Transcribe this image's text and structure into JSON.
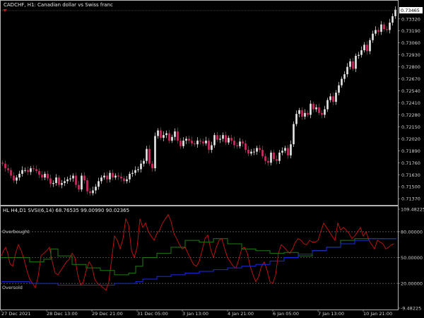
{
  "colors": {
    "background": "#000000",
    "frame": "#b4b4b4",
    "candle_bull": "#e8e8e8",
    "candle_bear": "#d12a66",
    "price_tag_bg": "#ffffff",
    "price_tag_text": "#000000",
    "line_red": "#c81414",
    "line_green": "#1f7a14",
    "line_blue": "#1a2ae6",
    "level_line": "#8c8c8c"
  },
  "chart_title": "CADCHF,  H1:  Canadian dollar vs Swiss franc",
  "current_price_tag": "0.73465",
  "icon": "arrow-down-icon",
  "price_scale": [
    "0.73320",
    "0.73190",
    "0.73060",
    "0.72930",
    "0.72800",
    "0.72670",
    "0.72540",
    "0.72410",
    "0.72280",
    "0.72150",
    "0.72020",
    "0.71890",
    "0.71760",
    "0.71630",
    "0.71500",
    "0.71370"
  ],
  "indicator_title": "HL H4,D1 SVSI(6,14) 68.76535 99.00990 90.02365",
  "indicator_scale": [
    "109.48225",
    "80.00000",
    "50.00000",
    "20.00000",
    "-9.48225"
  ],
  "levels": {
    "overbought": "Overbought",
    "oversold": "Oversold"
  },
  "time_labels": [
    "27 Dec 2021",
    "28 Dec 13:00",
    "29 Dec 21:00",
    "31 Dec 05:00",
    "3 Jan 13:00",
    "4 Jan 21:00",
    "6 Jan 05:00",
    "7 Jan 13:00",
    "10 Jan 21:00"
  ],
  "chart_data": [
    {
      "type": "candlestick",
      "title": "CADCHF,  H1:  Canadian dollar vs Swiss franc",
      "ylim": [
        0.7131,
        0.7351
      ],
      "x": [
        0,
        4,
        8,
        12,
        16,
        20,
        24,
        28,
        32,
        36,
        40,
        44,
        48,
        52,
        56,
        60,
        64,
        68,
        72,
        76,
        80,
        84,
        88,
        92,
        96,
        100,
        104,
        108,
        112,
        116,
        120,
        124,
        128,
        132,
        136,
        140,
        144,
        148,
        152,
        156,
        160,
        164,
        168,
        172,
        176,
        180,
        184,
        188,
        192,
        196,
        200,
        204,
        208,
        212,
        216,
        220,
        224,
        228,
        232,
        236,
        240,
        244,
        248,
        252,
        256,
        260,
        264,
        268,
        272,
        276,
        280,
        284,
        288,
        292,
        296,
        300,
        304,
        308,
        312,
        316,
        320,
        324,
        328,
        332,
        336,
        340,
        344,
        348,
        352,
        356,
        360,
        364,
        368,
        372,
        376,
        380,
        384,
        388,
        392,
        396,
        400,
        404,
        408,
        412,
        416,
        420,
        424,
        428,
        432,
        436,
        440,
        444,
        448,
        452,
        456,
        460,
        464,
        468,
        472,
        476,
        480,
        484,
        488,
        492,
        496,
        500,
        504,
        508,
        512,
        516,
        520,
        524,
        528,
        532,
        536,
        540,
        544,
        548,
        552,
        556
      ],
      "close": [
        0.7175,
        0.717,
        0.7168,
        0.7162,
        0.71567,
        0.716,
        0.7164,
        0.7168,
        0.7168,
        0.7166,
        0.717,
        0.7169,
        0.7167,
        0.7163,
        0.716,
        0.7164,
        0.7159,
        0.7153,
        0.7154,
        0.716,
        0.7152,
        0.7154,
        0.7156,
        0.7158,
        0.7159,
        0.7162,
        0.7152,
        0.7147,
        0.7162,
        0.7157,
        0.7145,
        0.7143,
        0.7146,
        0.715,
        0.7156,
        0.716,
        0.7162,
        0.7158,
        0.7165,
        0.716,
        0.7162,
        0.7161,
        0.7159,
        0.7156,
        0.7158,
        0.7164,
        0.7165,
        0.7168,
        0.7169,
        0.7175,
        0.7178,
        0.7191,
        0.7175,
        0.717,
        0.7205,
        0.7211,
        0.7203,
        0.7206,
        0.7208,
        0.72,
        0.7204,
        0.721,
        0.72,
        0.7194,
        0.72,
        0.7202,
        0.72,
        0.7197,
        0.7196,
        0.72,
        0.7199,
        0.7197,
        0.72,
        0.719,
        0.7195,
        0.7206,
        0.7201,
        0.7202,
        0.7206,
        0.7198,
        0.7203,
        0.72,
        0.7195,
        0.7194,
        0.7199,
        0.7197,
        0.719,
        0.7186,
        0.7188,
        0.7188,
        0.7192,
        0.719,
        0.7183,
        0.7178,
        0.7176,
        0.7187,
        0.718,
        0.7178,
        0.7187,
        0.7189,
        0.7192,
        0.7184,
        0.7196,
        0.7218,
        0.7229,
        0.7233,
        0.7226,
        0.723,
        0.7228,
        0.724,
        0.7234,
        0.7236,
        0.723,
        0.7228,
        0.7234,
        0.7244,
        0.7248,
        0.7242,
        0.7252,
        0.726,
        0.7267,
        0.7272,
        0.728,
        0.7286,
        0.7278,
        0.7292,
        0.7293,
        0.7298,
        0.7304,
        0.7297,
        0.7309,
        0.7316,
        0.732,
        0.7318,
        0.7326,
        0.7321,
        0.732,
        0.7328,
        0.7335,
        0.7342
      ]
    },
    {
      "type": "line",
      "title": "HL H4,D1 SVSI(6,14) 68.76535 99.00990 90.02365",
      "ylim": [
        -9.48225,
        109.48225
      ],
      "series": [
        {
          "x": [
            0,
            3,
            6,
            9,
            12,
            16,
            20,
            24,
            28,
            32,
            36,
            40,
            44,
            48,
            52,
            56,
            60,
            64,
            68,
            72,
            76,
            80,
            84,
            88,
            92,
            96,
            100,
            104,
            108,
            112,
            116,
            120,
            124,
            128,
            132,
            136,
            140,
            144,
            148,
            152,
            156,
            160,
            164,
            168,
            172,
            176,
            180,
            184,
            188,
            192,
            196,
            200,
            204,
            208,
            212,
            216,
            220,
            224,
            228,
            232,
            236,
            240,
            244,
            248,
            252,
            256,
            260,
            264,
            268,
            272,
            276,
            280,
            284,
            288,
            292,
            296,
            300,
            304,
            308,
            312,
            316,
            320,
            324,
            328,
            332,
            336,
            340,
            344,
            348,
            352,
            356,
            360,
            364,
            368,
            372,
            376,
            380,
            384,
            388,
            392,
            396,
            400,
            404,
            408,
            412,
            416,
            420,
            424,
            428,
            432,
            436,
            440,
            444,
            448,
            452,
            456,
            460,
            464,
            468,
            472,
            476,
            480,
            484,
            488,
            492,
            496,
            500,
            504,
            508,
            512,
            516,
            520,
            524,
            528,
            532,
            536,
            540,
            544,
            548,
            552,
            556
          ],
          "values": [
            52,
            58,
            62,
            55,
            43,
            40,
            55,
            65,
            58,
            48,
            35,
            25,
            20,
            15,
            28,
            52,
            55,
            58,
            62,
            45,
            32,
            30,
            35,
            40,
            45,
            48,
            55,
            50,
            30,
            18,
            22,
            35,
            45,
            40,
            25,
            20,
            18,
            15,
            12,
            22,
            48,
            75,
            70,
            60,
            72,
            95,
            88,
            58,
            50,
            62,
            95,
            85,
            90,
            80,
            75,
            70,
            78,
            82,
            90,
            95,
            100,
            92,
            78,
            72,
            65,
            60,
            62,
            55,
            48,
            42,
            40,
            46,
            58,
            72,
            76,
            60,
            50,
            62,
            70,
            72,
            60,
            50,
            45,
            40,
            38,
            48,
            60,
            62,
            55,
            40,
            30,
            22,
            28,
            40,
            45,
            35,
            22,
            20,
            30,
            55,
            65,
            62,
            58,
            55,
            60,
            68,
            72,
            70,
            66,
            65,
            70,
            68,
            68,
            70,
            80,
            90,
            85,
            80,
            75,
            70,
            90,
            82,
            85,
            82,
            78,
            72,
            75,
            80,
            85,
            75,
            80,
            70,
            65,
            60,
            70,
            68,
            66,
            60,
            62,
            65,
            66
          ]
        },
        {
          "x": [
            0,
            40,
            60,
            70,
            80,
            100,
            120,
            140,
            160,
            180,
            190,
            200,
            220,
            240,
            260,
            280,
            300,
            320,
            340,
            360,
            380,
            400,
            420,
            440,
            460,
            480,
            500,
            520,
            540,
            560
          ],
          "values": [
            50,
            45,
            48,
            60,
            52,
            42,
            38,
            35,
            30,
            32,
            40,
            50,
            55,
            62,
            70,
            68,
            72,
            66,
            60,
            58,
            55,
            56,
            52,
            58,
            62,
            70,
            72,
            72,
            72,
            72
          ]
        },
        {
          "x": [
            0,
            40,
            80,
            120,
            160,
            190,
            200,
            220,
            240,
            260,
            280,
            300,
            320,
            340,
            360,
            380,
            400,
            420,
            440,
            460,
            480,
            500,
            520,
            540,
            560
          ],
          "values": [
            22,
            20,
            18,
            18,
            20,
            22,
            25,
            28,
            30,
            32,
            34,
            36,
            38,
            40,
            42,
            46,
            50,
            54,
            58,
            62,
            66,
            70,
            72,
            72,
            72
          ]
        }
      ],
      "levels": {
        "overbought": 80,
        "middle": 50,
        "oversold": 20
      }
    }
  ]
}
